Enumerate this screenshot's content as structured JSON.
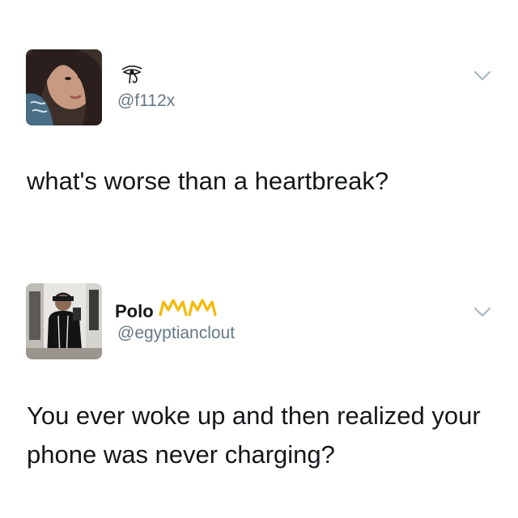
{
  "tweets": [
    {
      "display_name": "",
      "name_icon": "eye-of-horus-icon",
      "handle": "@f112x",
      "text": "what's worse than a heartbreak?",
      "menu_icon": "chevron-down-icon"
    },
    {
      "display_name": "Polo",
      "name_icon": "crown-emoji-icon",
      "handle": "@egyptianclout",
      "text": "You ever woke up and then realized your phone was never charging?",
      "menu_icon": "chevron-down-icon"
    }
  ],
  "colors": {
    "text": "#14171a",
    "handle": "#657786",
    "chevron": "#aab8c2",
    "crown": "#f5b800"
  }
}
